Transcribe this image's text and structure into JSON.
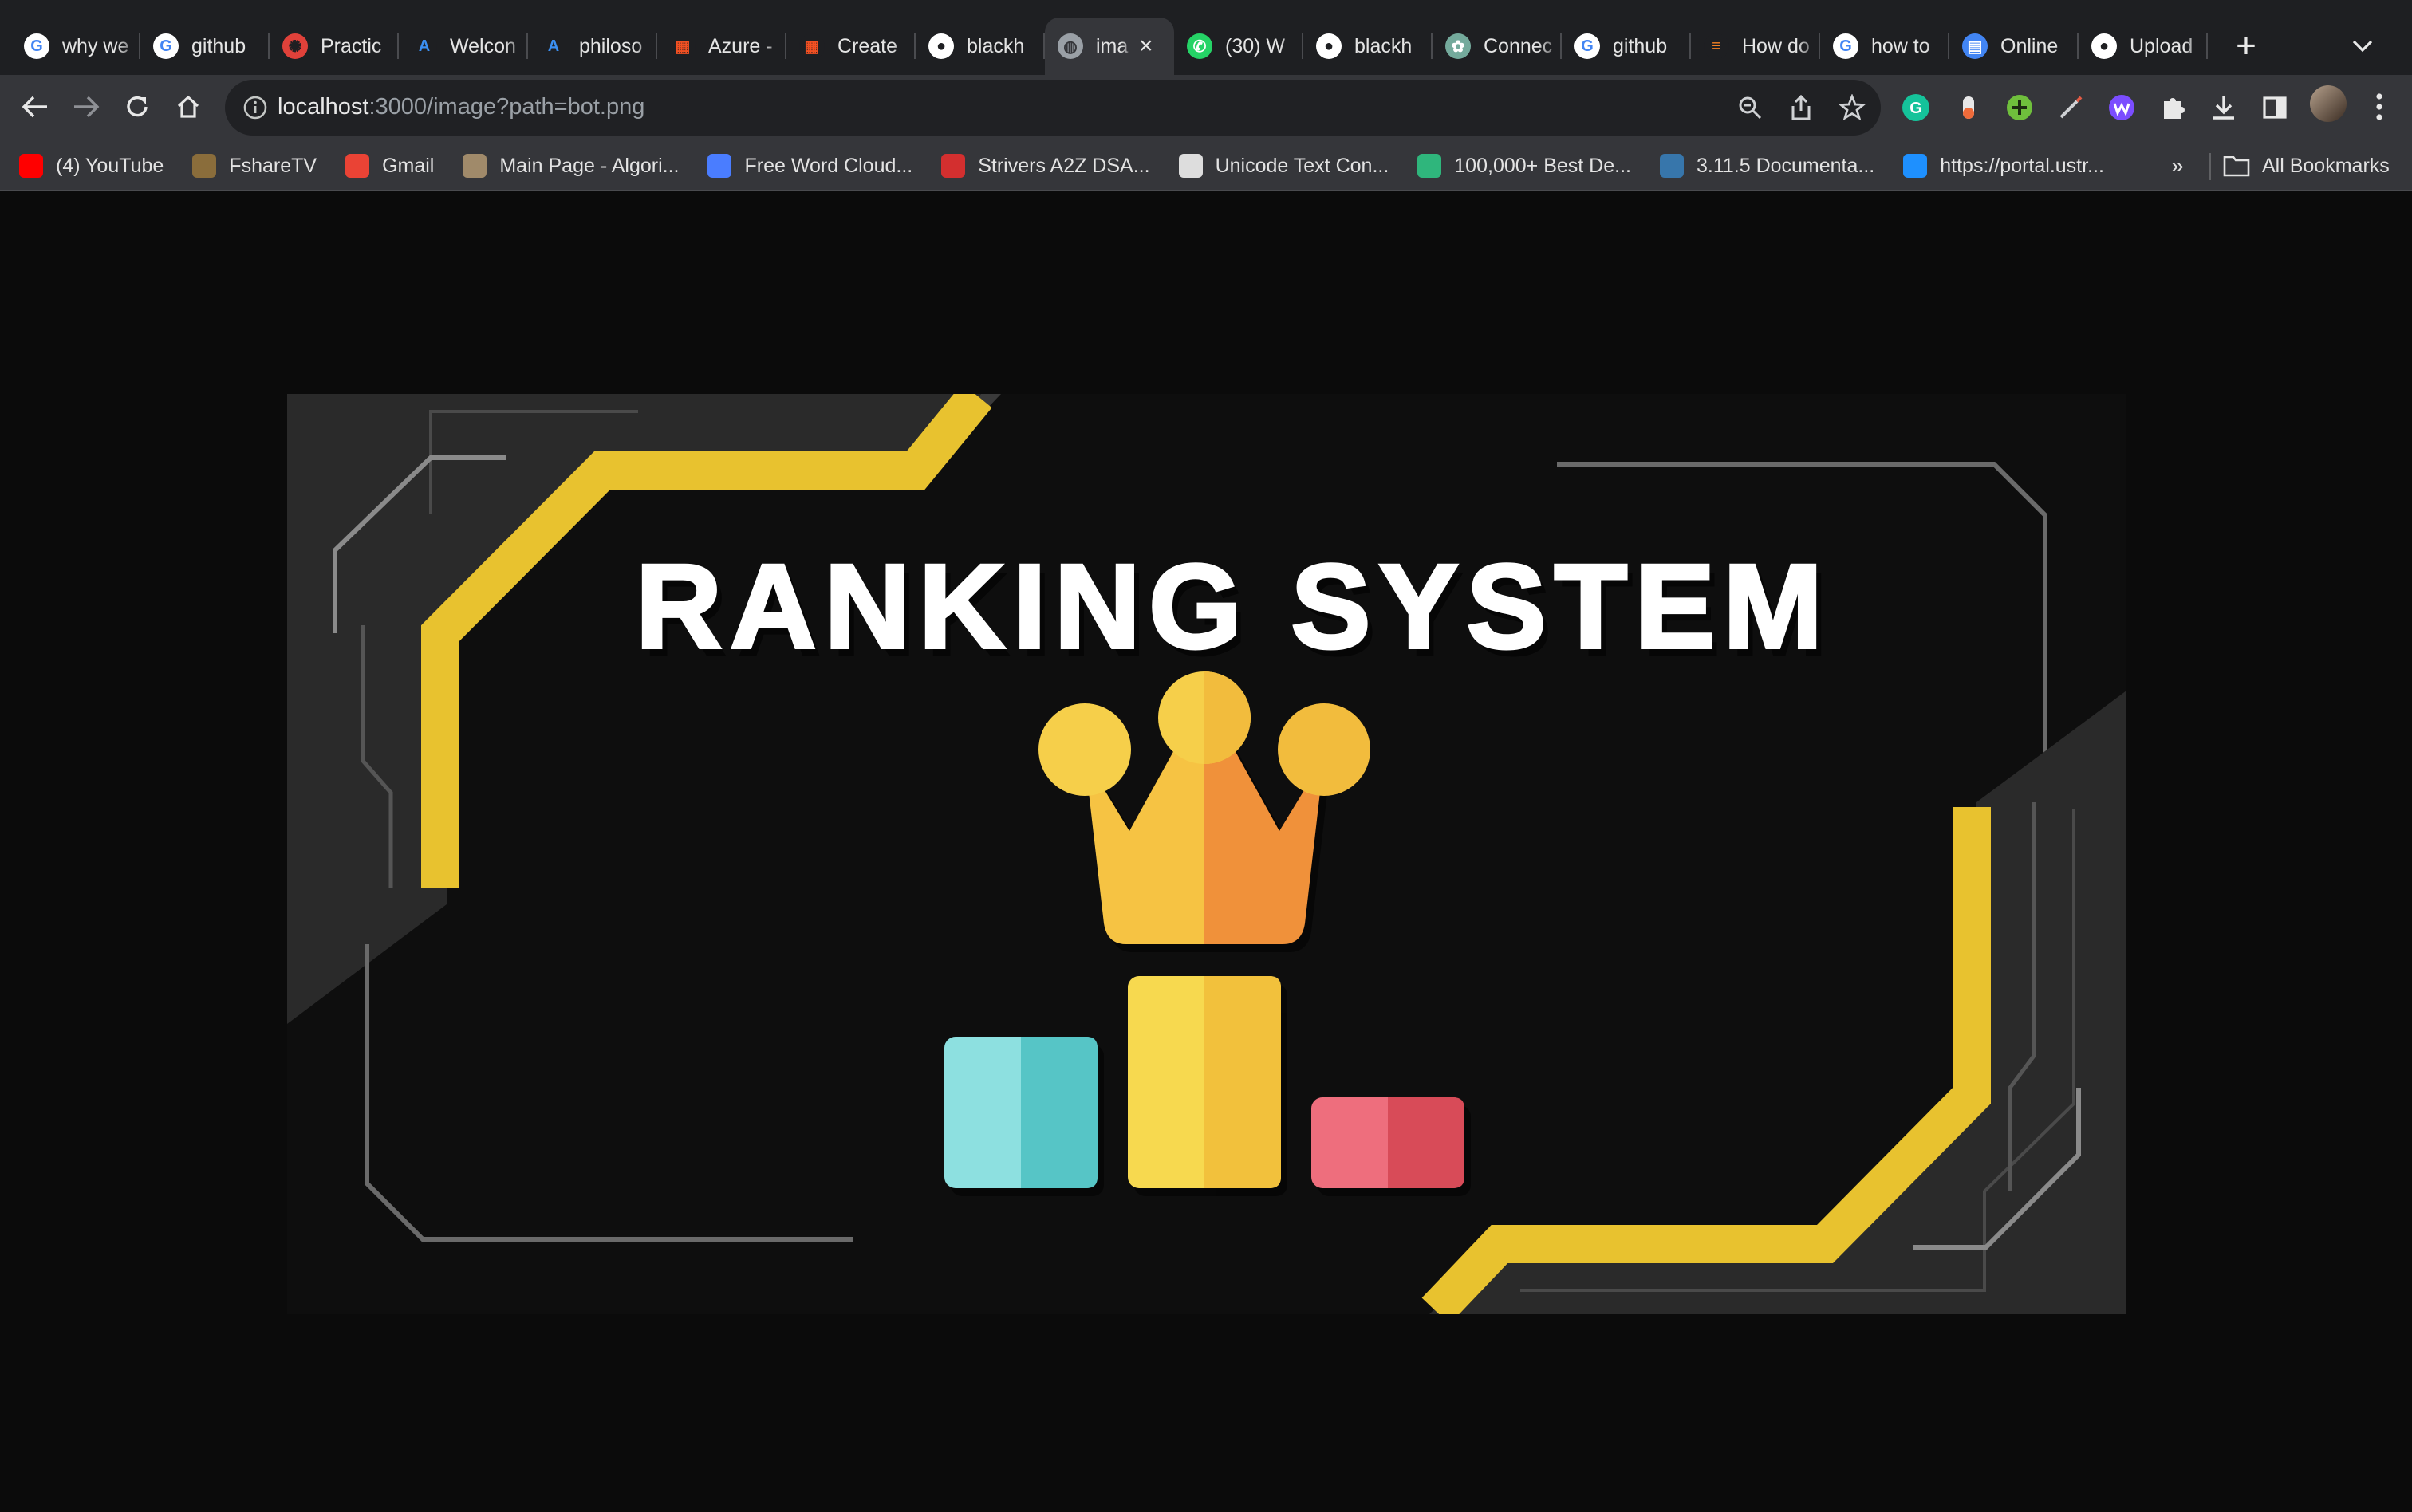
{
  "tabs": [
    {
      "title": "why we",
      "icon": "google-icon",
      "active": false
    },
    {
      "title": "github",
      "icon": "google-icon",
      "active": false
    },
    {
      "title": "Practic",
      "icon": "practice-icon",
      "active": false
    },
    {
      "title": "Welcon",
      "icon": "azure-icon",
      "active": false
    },
    {
      "title": "philoso",
      "icon": "azure-icon",
      "active": false
    },
    {
      "title": "Azure -",
      "icon": "microsoft-icon",
      "active": false
    },
    {
      "title": "Create",
      "icon": "microsoft-icon",
      "active": false
    },
    {
      "title": "blackh",
      "icon": "github-icon",
      "active": false
    },
    {
      "title": "ima",
      "icon": "globe-icon",
      "active": true
    },
    {
      "title": "(30) W",
      "icon": "whatsapp-icon",
      "active": false
    },
    {
      "title": "blackh",
      "icon": "github-icon",
      "active": false
    },
    {
      "title": "Connec",
      "icon": "chatgpt-icon",
      "active": false
    },
    {
      "title": "github",
      "icon": "google-icon",
      "active": false
    },
    {
      "title": "How do",
      "icon": "stackoverflow-icon",
      "active": false
    },
    {
      "title": "how to",
      "icon": "google-icon",
      "active": false
    },
    {
      "title": "Online",
      "icon": "docs-icon",
      "active": false
    },
    {
      "title": "Upload",
      "icon": "github-icon",
      "active": false
    }
  ],
  "address_bar": {
    "host": "localhost",
    "path": ":3000/image?path=bot.png"
  },
  "bookmarks": [
    {
      "label": "(4) YouTube",
      "icon": "youtube-icon",
      "color": "#ff0000"
    },
    {
      "label": "FshareTV",
      "icon": "fsharetv-icon",
      "color": "#8a6d3b"
    },
    {
      "label": "Gmail",
      "icon": "gmail-icon",
      "color": "#ea4335"
    },
    {
      "label": "Main Page - Algori...",
      "icon": "algorithms-icon",
      "color": "#a08a6a"
    },
    {
      "label": "Free Word Cloud...",
      "icon": "wordcloud-icon",
      "color": "#4a7dff"
    },
    {
      "label": "Strivers A2Z DSA...",
      "icon": "takeuforward-icon",
      "color": "#d32f2f"
    },
    {
      "label": "Unicode Text Con...",
      "icon": "unicode-icon",
      "color": "#dddddd"
    },
    {
      "label": "100,000+ Best De...",
      "icon": "pexels-icon",
      "color": "#2fb67c"
    },
    {
      "label": "3.11.5 Documenta...",
      "icon": "python-icon",
      "color": "#3776ab"
    },
    {
      "label": "https://portal.ustr...",
      "icon": "cloud-icon",
      "color": "#1e90ff"
    }
  ],
  "bookmarks_overflow": "»",
  "all_bookmarks_label": "All Bookmarks",
  "banner": {
    "title": "RANKING SYSTEM",
    "colors": {
      "gold": "#e8c22f",
      "crown_light": "#f6cf4a",
      "crown_dark": "#f0913a",
      "teal": "#5ec9cb",
      "yellow": "#f7d44c",
      "red": "#e05562",
      "panel": "#2b2b2b"
    }
  }
}
